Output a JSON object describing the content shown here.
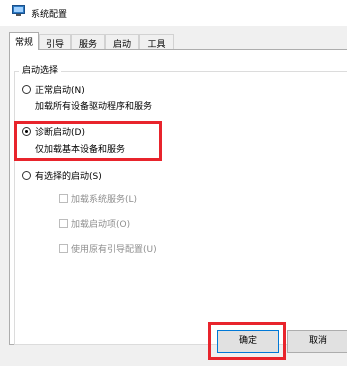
{
  "window": {
    "title": "系统配置"
  },
  "tabs": [
    {
      "label": "常规",
      "active": true
    },
    {
      "label": "引导",
      "active": false
    },
    {
      "label": "服务",
      "active": false
    },
    {
      "label": "启动",
      "active": false
    },
    {
      "label": "工具",
      "active": false
    }
  ],
  "startup_selection": {
    "group_label": "启动选择",
    "normal": {
      "label": "正常启动(N)",
      "description": "加载所有设备驱动程序和服务",
      "checked": false
    },
    "diagnostic": {
      "label": "诊断启动(D)",
      "description": "仅加载基本设备和服务",
      "checked": true
    },
    "selective": {
      "label": "有选择的启动(S)",
      "checked": false,
      "options": [
        {
          "label": "加载系统服务(L)",
          "checked": false,
          "enabled": false
        },
        {
          "label": "加载启动项(O)",
          "checked": false,
          "enabled": false
        },
        {
          "label": "使用原有引导配置(U)",
          "checked": false,
          "enabled": false
        }
      ]
    }
  },
  "buttons": {
    "ok": "确定",
    "cancel": "取消"
  },
  "colors": {
    "highlight": "#e8242c",
    "accent": "#0078d7"
  }
}
